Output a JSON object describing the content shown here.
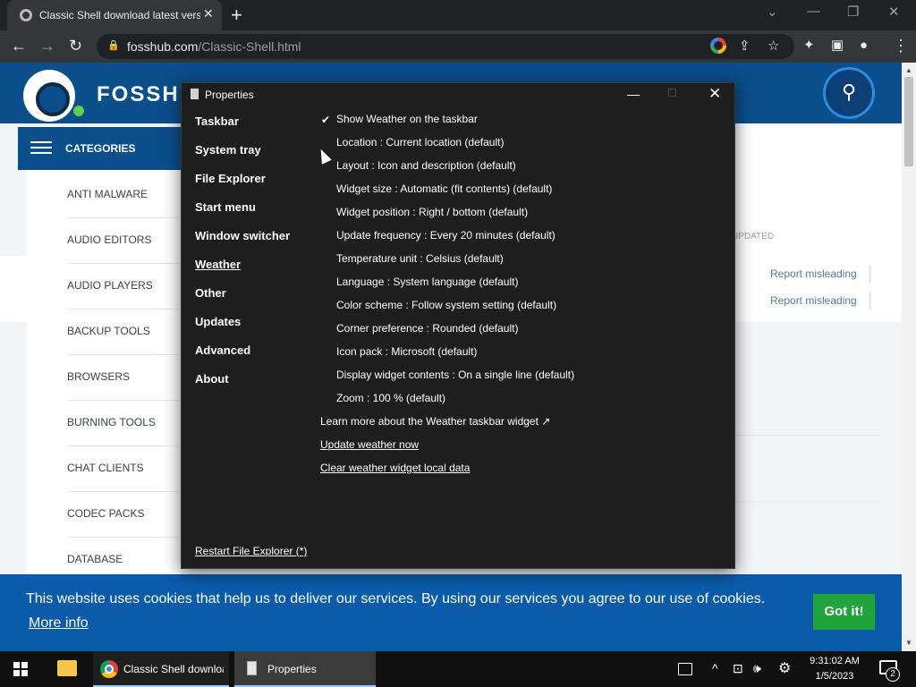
{
  "browser": {
    "tab_title": "Classic Shell download latest version",
    "tab_close": "✕",
    "new_tab": "+",
    "url_host": "fosshub.com",
    "url_path": "/Classic-Shell.html",
    "window_controls": {
      "chevron": "⌄",
      "minimize": "—",
      "restore": "❐",
      "close": "✕"
    },
    "toolbar_icons": {
      "back": "←",
      "forward": "→",
      "reload": "↻",
      "share": "⇪",
      "star": "☆",
      "extensions": "✦",
      "sidebar": "▣",
      "profile": "●",
      "menu": "⋮"
    }
  },
  "site": {
    "logo_text": "FOSSHUB",
    "search_icon": "⚲",
    "categories_label": "CATEGORIES",
    "categories": [
      "ANTI MALWARE",
      "AUDIO EDITORS",
      "AUDIO PLAYERS",
      "BACKUP TOOLS",
      "BROWSERS",
      "BURNING TOOLS",
      "CHAT CLIENTS",
      "CODEC PACKS",
      "DATABASE"
    ],
    "updated_label": "UPDATED",
    "report_links": [
      "Report misleading",
      "Report misleading"
    ]
  },
  "cookie": {
    "text": "This website uses cookies that help us to deliver our services. By using our services you agree to our use of cookies.",
    "more_info": "More info",
    "button": "Got it!"
  },
  "dialog": {
    "title": "Properties",
    "controls": {
      "minimize": "—",
      "maximize": "□",
      "close": "✕"
    },
    "nav": [
      "Taskbar",
      "System tray",
      "File Explorer",
      "Start menu",
      "Window switcher",
      "Weather",
      "Other",
      "Updates",
      "Advanced",
      "About"
    ],
    "active_nav": "Weather",
    "check_mark": "✔",
    "options": [
      "Show Weather on the taskbar",
      "Location : Current location (default)",
      "Layout : Icon and description (default)",
      "Widget size : Automatic (fit contents) (default)",
      "Widget position : Right / bottom (default)",
      "Update frequency : Every 20 minutes (default)",
      "Temperature unit : Celsius (default)",
      "Language : System language (default)",
      "Color scheme : Follow system setting (default)",
      "Corner preference : Rounded (default)",
      "Icon pack : Microsoft (default)",
      "Display widget contents : On a single line (default)",
      "Zoom : 100 % (default)"
    ],
    "learn_more": "Learn more about the Weather taskbar widget ↗",
    "update_now": "Update weather now",
    "clear_data": "Clear weather widget local data",
    "restart": "Restart File Explorer (*)"
  },
  "taskbar": {
    "chrome_task": "Classic Shell download latest version",
    "props_task": "Properties",
    "tray_icons": {
      "chevron": "^",
      "network": "⊡",
      "volume": "🕪",
      "settings": "⚙"
    },
    "time": "9:31:02 AM",
    "date": "1/5/2023",
    "notifications": "2"
  },
  "colors": {
    "site_blue": "#0a4e8b",
    "cookie_blue": "#0b5bab",
    "got_it_green": "#1fa53a",
    "dialog_bg": "#1e1e1e"
  }
}
